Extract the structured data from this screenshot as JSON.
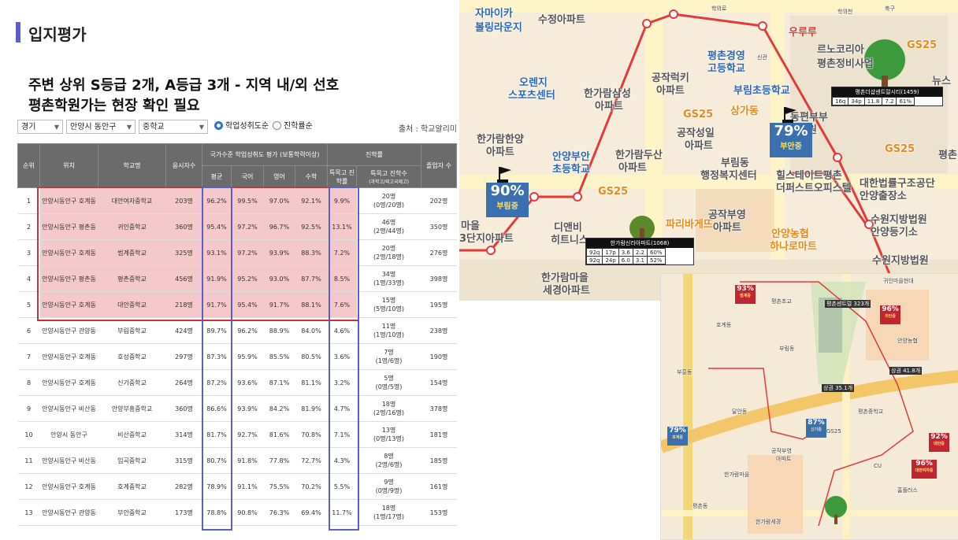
{
  "page": {
    "title": "입지평가",
    "headline_1": "주변 상위 S등급 2개, A등급 3개 - 지역 내/외 선호",
    "headline_2": "평촌학원가는 현장 확인 필요"
  },
  "filters": {
    "region": "경기",
    "district": "안양시 동안구",
    "school_type": "중학교",
    "radio_1": "학업성취도순",
    "radio_2": "진학률순",
    "source": "출처 : 학교알리미"
  },
  "table": {
    "headers": {
      "rank": "순위",
      "location": "위치",
      "school": "학교명",
      "applicants": "응시자수",
      "group_achievement": "국가수준 학업성취도 평가 (보통학력이상)",
      "avg": "평균",
      "korean": "국어",
      "english": "영어",
      "math": "수학",
      "group_advance": "진학률",
      "special_rate": "특목고 진학률",
      "special_count": "특목고 진학수",
      "special_count_sub": "(과학고/외고국제고)",
      "graduates": "졸업자 수"
    },
    "rows": [
      {
        "rank": "1",
        "location": "안양시동안구 호계동",
        "school": "대안여자중학교",
        "applicants": "203명",
        "avg": "96.2%",
        "korean": "99.5%",
        "english": "97.0%",
        "math": "92.1%",
        "special_rate": "9.9%",
        "special_count": "20명",
        "special_detail": "(0명/20명)",
        "graduates": "202명"
      },
      {
        "rank": "2",
        "location": "안양시동안구 평촌동",
        "school": "귀인중학교",
        "applicants": "360명",
        "avg": "95.4%",
        "korean": "97.2%",
        "english": "96.7%",
        "math": "92.5%",
        "special_rate": "13.1%",
        "special_count": "46명",
        "special_detail": "(2명/44명)",
        "graduates": "350명"
      },
      {
        "rank": "3",
        "location": "안양시동안구 호계동",
        "school": "범계중학교",
        "applicants": "325명",
        "avg": "93.1%",
        "korean": "97.2%",
        "english": "93.9%",
        "math": "88.3%",
        "special_rate": "7.2%",
        "special_count": "20명",
        "special_detail": "(2명/18명)",
        "graduates": "276명"
      },
      {
        "rank": "4",
        "location": "안양시동안구 평촌동",
        "school": "평촌중학교",
        "applicants": "456명",
        "avg": "91.9%",
        "korean": "95.2%",
        "english": "93.0%",
        "math": "87.7%",
        "special_rate": "8.5%",
        "special_count": "34명",
        "special_detail": "(1명/33명)",
        "graduates": "398명"
      },
      {
        "rank": "5",
        "location": "안양시동안구 호계동",
        "school": "대안중학교",
        "applicants": "218명",
        "avg": "91.7%",
        "korean": "95.4%",
        "english": "91.7%",
        "math": "88.1%",
        "special_rate": "7.6%",
        "special_count": "15명",
        "special_detail": "(5명/10명)",
        "graduates": "195명"
      },
      {
        "rank": "6",
        "location": "안양시동안구 관양동",
        "school": "부림중학교",
        "applicants": "424명",
        "avg": "89.7%",
        "korean": "96.2%",
        "english": "88.9%",
        "math": "84.0%",
        "special_rate": "4.6%",
        "special_count": "11명",
        "special_detail": "(1명/10명)",
        "graduates": "238명"
      },
      {
        "rank": "7",
        "location": "안양시동안구 호계동",
        "school": "호성중학교",
        "applicants": "297명",
        "avg": "87.3%",
        "korean": "95.9%",
        "english": "85.5%",
        "math": "80.5%",
        "special_rate": "3.6%",
        "special_count": "7명",
        "special_detail": "(1명/6명)",
        "graduates": "190명"
      },
      {
        "rank": "8",
        "location": "안양시동안구 호계동",
        "school": "신기중학교",
        "applicants": "264명",
        "avg": "87.2%",
        "korean": "93.6%",
        "english": "87.1%",
        "math": "81.1%",
        "special_rate": "3.2%",
        "special_count": "5명",
        "special_detail": "(0명/5명)",
        "graduates": "154명"
      },
      {
        "rank": "9",
        "location": "안양시동안구 비산동",
        "school": "안양부흥중학교",
        "applicants": "360명",
        "avg": "86.6%",
        "korean": "93.9%",
        "english": "84.2%",
        "math": "81.9%",
        "special_rate": "4.7%",
        "special_count": "18명",
        "special_detail": "(2명/16명)",
        "graduates": "378명"
      },
      {
        "rank": "10",
        "location": "안양시 동안구",
        "school": "비산중학교",
        "applicants": "314명",
        "avg": "81.7%",
        "korean": "92.7%",
        "english": "81.6%",
        "math": "70.8%",
        "special_rate": "7.1%",
        "special_count": "13명",
        "special_detail": "(0명/13명)",
        "graduates": "181명"
      },
      {
        "rank": "11",
        "location": "안양시동안구 비산동",
        "school": "임곡중학교",
        "applicants": "315명",
        "avg": "80.7%",
        "korean": "91.8%",
        "english": "77.8%",
        "math": "72.7%",
        "special_rate": "4.3%",
        "special_count": "8명",
        "special_detail": "(2명/6명)",
        "graduates": "185명"
      },
      {
        "rank": "12",
        "location": "안양시동안구 호계동",
        "school": "호계중학교",
        "applicants": "282명",
        "avg": "78.9%",
        "korean": "91.1%",
        "english": "75.5%",
        "math": "70.2%",
        "special_rate": "5.5%",
        "special_count": "9명",
        "special_detail": "(0명/9명)",
        "graduates": "161명"
      },
      {
        "rank": "13",
        "location": "안양시동안구 관양동",
        "school": "부안중학교",
        "applicants": "173명",
        "avg": "78.8%",
        "korean": "90.8%",
        "english": "76.3%",
        "math": "69.4%",
        "special_rate": "11.7%",
        "special_count": "18명",
        "special_detail": "(1명/17명)",
        "graduates": "153명"
      }
    ]
  },
  "map1": {
    "labels": {
      "zamika": "자마이카",
      "bowling": "볼링라운지",
      "sujeong": "수정아파트",
      "hakui": "학의로",
      "hakui2": "학의천",
      "ururu": "우루루",
      "chukgu": "축구",
      "renocorea": "르노코리아",
      "pyeongchon_repair": "평촌정비사업",
      "news": "뉴스",
      "pyeongchon_biz": "평촌경영",
      "biz_high": "고등학교",
      "singwan": "신관",
      "burim_elem": "부림초등학교",
      "orange_sports": "오렌지",
      "orange_sports2": "스포츠센터",
      "hangaram_samsung": "한가람삼성",
      "hangaram_samsung2": "아파트",
      "gongjak_leaf": "공작럭키",
      "gongjak_leaf2": "아파트",
      "sangga": "상가동",
      "gongjak_sungil": "공작성일",
      "gongjak_sungil2": "아파트",
      "hangaram_hanyang": "한가람한양",
      "hangaram_hanyang2": "아파트",
      "anyang_buan_elem": "안양부안",
      "anyang_buan_elem2": "초등학교",
      "hangaram_dusan": "한가람두산",
      "hangaram_dusan2": "아파트",
      "burim_dong": "부림동",
      "burim_office": "행정복지센터",
      "hillstate": "힐스테이트평촌",
      "hillstate2": "더퍼스트오피스텔",
      "court": "대한법률구조공단",
      "court2": "안양출장소",
      "pyeongchon_right": "평촌",
      "gs25_a": "GS25",
      "gs25_b": "GS25",
      "gs25_c": "GS25",
      "gs25_d": "GS25",
      "paris": "파리바게뜨",
      "gongjak_buyoung": "공작부영",
      "gongjak_buyoung2": "아파트",
      "maeul": "마을",
      "maeul2": "3단지아파트",
      "dn": "디앤비",
      "dn2": "히트니스",
      "nonghyup": "안양농협",
      "nonghyup2": "하나로마트",
      "suwon_court": "수원지방법원",
      "suwon_court2": "안양등기소",
      "suwon_court3": "수원지방법원",
      "hangaram_saegyeong": "한가람마을",
      "hangaram_saegyeong2": "세경아파트",
      "dongbu": "동편부부",
      "dongbu2": "인원"
    },
    "badge_left": {
      "pct": "90%",
      "name": "부림중"
    },
    "badge_right": {
      "pct": "79%",
      "name": "부안중"
    },
    "card_top": {
      "title": "평촌더샵센트럴시티(1459)",
      "cells": [
        "16q",
        "34p",
        "11.8",
        "7.2",
        "61%"
      ]
    },
    "card_bottom": {
      "title": "한가람신라아파트(1068)",
      "row1": [
        "92q",
        "17p",
        "3.6",
        "2.2",
        "60%"
      ],
      "row2": [
        "92q",
        "24p",
        "6.0",
        "3.1",
        "52%"
      ]
    },
    "colors": {
      "route": "#e23b3b",
      "badge_blue": "#3a6fb0",
      "badge_name": "#f9e06b"
    }
  },
  "map2": {
    "labels": {
      "hl1": "평촌센트럴 323개",
      "hl2": "상권 41.8개",
      "hl3": "상권 35.1개",
      "a1": "귀인마을현대",
      "a2": "평촌초교",
      "a3": "호계동",
      "a4": "부림동",
      "a5": "GS25",
      "a6": "안양농협",
      "a7": "평촌중학교",
      "a8": "부흥동",
      "a9": "달안동",
      "a10": "공작부영",
      "a11": "아파트",
      "a12": "한가람마을",
      "a13": "CU",
      "a14": "홈플러스",
      "a15": "평촌동",
      "a16": "한가람세경"
    },
    "badges": {
      "b1": {
        "pct": "93%",
        "name": "범계중"
      },
      "b2": {
        "pct": "96%",
        "name": "귀인중"
      },
      "b3": {
        "pct": "87%",
        "name": "신기중"
      },
      "b4": {
        "pct": "79%",
        "name": "호계중"
      },
      "b5": {
        "pct": "92%",
        "name": "대안중"
      },
      "b6": {
        "pct": "96%",
        "name": "대안여자중"
      }
    }
  }
}
